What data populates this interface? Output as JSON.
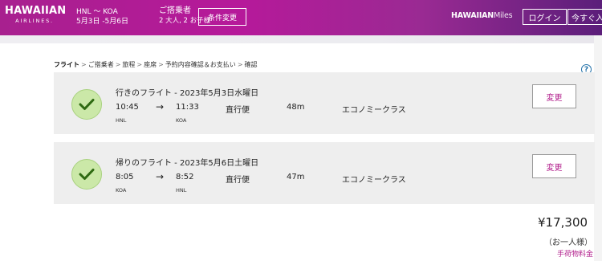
{
  "header": {
    "logo_main": "HAWAIIAN",
    "logo_sub": "AIRLINES.",
    "route": "HNL 〜 KOA",
    "dates": "5月3日 -5月6日",
    "pax_title": "ご搭乗者",
    "pax_detail": "2 大人, 2 お子様",
    "modify_button": "条件変更",
    "miles_brand": "HAWAIIAN",
    "miles_suffix": "Miles",
    "login": "ログイン",
    "join_now": "今すぐ入"
  },
  "breadcrumb": [
    "フライト",
    "ご搭乗者",
    "旅程",
    "座席",
    "予約内容確認＆お支払い",
    "確認"
  ],
  "breadcrumb_separator": ">",
  "help_icon_text": "?",
  "flights": [
    {
      "title": "行きのフライト - 2023年5月3日水曜日",
      "depart_time": "10:45",
      "depart_code": "HNL",
      "arrow": "→",
      "arrive_time": "11:33",
      "arrive_code": "KOA",
      "type": "直行便",
      "duration": "48m",
      "cabin": "エコノミークラス",
      "change_button": "変更"
    },
    {
      "title": "帰りのフライト - 2023年5月6日土曜日",
      "depart_time": "8:05",
      "depart_code": "KOA",
      "arrow": "→",
      "arrive_time": "8:52",
      "arrive_code": "HNL",
      "type": "直行便",
      "duration": "47m",
      "cabin": "エコノミークラス",
      "change_button": "変更"
    }
  ],
  "price": {
    "amount": "¥17,300",
    "per_person": "（お一人様）",
    "baggage_link": "手荷物料金"
  },
  "colors": {
    "brand_magenta": "#b6199a",
    "brand_purple": "#5b1e7a",
    "check_green": "#cbe8a8",
    "link_magenta": "#b21f8c",
    "help_blue": "#1f6fa8"
  }
}
